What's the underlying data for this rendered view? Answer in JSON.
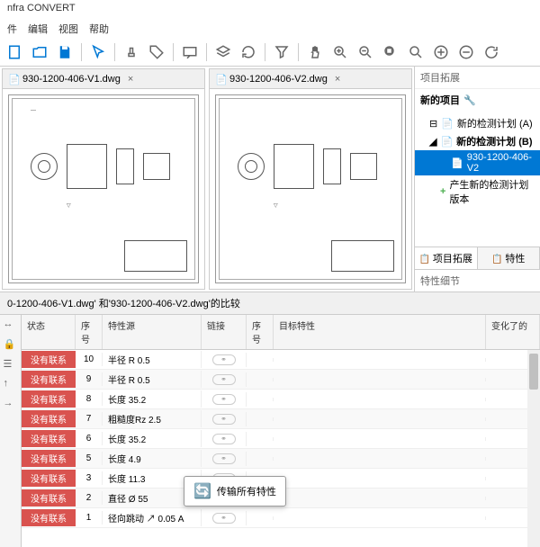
{
  "app": {
    "title": "nfra CONVERT"
  },
  "menu": {
    "items": [
      "件",
      "编辑",
      "视图",
      "帮助"
    ]
  },
  "tabs": {
    "left": {
      "label": "930-1200-406-V1.dwg"
    },
    "right": {
      "label": "930-1200-406-V2.dwg"
    }
  },
  "rightpanel": {
    "head": "项目拓展",
    "title": "新的项目",
    "planA": "新的检测计划 (A)",
    "planB": "新的检测计划 (B)",
    "file": "930-1200-406-V2",
    "newVersion": "产生新的检测计划版本",
    "tabExpand": "项目拓展",
    "tabProps": "特性",
    "detail": "特性细节"
  },
  "compare": {
    "title": "0-1200-406-V1.dwg' 和'930-1200-406-V2.dwg'的比较"
  },
  "grid": {
    "headers": {
      "status": "状态",
      "num": "序号",
      "src": "特性源",
      "link": "链接",
      "num2": "序号",
      "tgt": "目标特性",
      "chg": "变化了的"
    },
    "noRelation": "没有联系",
    "rows": [
      {
        "n": "1",
        "src": "径向跳动 ↗ 0.05 A"
      },
      {
        "n": "2",
        "src": "直径 Ø 55"
      },
      {
        "n": "3",
        "src": "长度 11.3"
      },
      {
        "n": "5",
        "src": "长度 4.9"
      },
      {
        "n": "6",
        "src": "长度 35.2"
      },
      {
        "n": "7",
        "src": "粗糙度Rz 2.5"
      },
      {
        "n": "8",
        "src": "长度 35.2"
      },
      {
        "n": "9",
        "src": "半径 R 0.5"
      },
      {
        "n": "10",
        "src": "半径 R 0.5"
      }
    ]
  },
  "popup": {
    "label": "传输所有特性"
  }
}
